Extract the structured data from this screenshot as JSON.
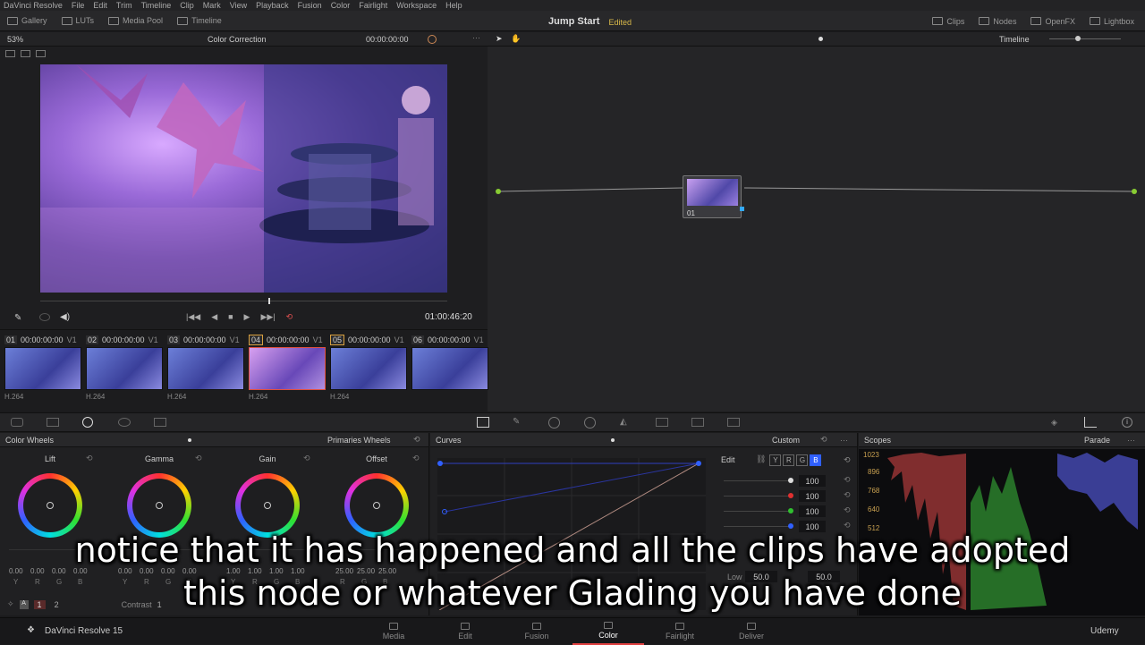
{
  "menu": [
    "DaVinci Resolve",
    "File",
    "Edit",
    "Trim",
    "Timeline",
    "Clip",
    "Mark",
    "View",
    "Playback",
    "Fusion",
    "Color",
    "Fairlight",
    "Workspace",
    "Help"
  ],
  "toolbar": {
    "left": [
      "Gallery",
      "LUTs",
      "Media Pool",
      "Timeline"
    ],
    "project_title": "Jump Start",
    "project_status": "Edited",
    "right": [
      "Clips",
      "Nodes",
      "OpenFX",
      "Lightbox"
    ]
  },
  "viewer": {
    "zoom": "53%",
    "mode": "Color Correction",
    "timecode": "00:00:00:00",
    "playhead_timecode": "01:00:46:20",
    "playhead_fraction": 0.56
  },
  "node_editor": {
    "label": "Timeline",
    "node_label": "01"
  },
  "clips": [
    {
      "num": "01",
      "tc": "00:00:00:00",
      "track": "V1",
      "codec": "H.264"
    },
    {
      "num": "02",
      "tc": "00:00:00:00",
      "track": "V1",
      "codec": "H.264"
    },
    {
      "num": "03",
      "tc": "00:00:00:00",
      "track": "V1",
      "codec": "H.264"
    },
    {
      "num": "04",
      "tc": "00:00:00:00",
      "track": "V1",
      "codec": "H.264"
    },
    {
      "num": "05",
      "tc": "00:00:00:00",
      "track": "V1",
      "codec": "H.264"
    },
    {
      "num": "06",
      "tc": "00:00:00:00",
      "track": "V1",
      "codec": ""
    }
  ],
  "color_wheels": {
    "title": "Color Wheels",
    "mode": "Primaries Wheels",
    "wheels": [
      {
        "label": "Lift",
        "values": [
          "0.00",
          "0.00",
          "0.00",
          "0.00"
        ],
        "channels": [
          "Y",
          "R",
          "G",
          "B"
        ]
      },
      {
        "label": "Gamma",
        "values": [
          "0.00",
          "0.00",
          "0.00",
          "0.00"
        ],
        "channels": [
          "Y",
          "R",
          "G",
          "B"
        ]
      },
      {
        "label": "Gain",
        "values": [
          "1.00",
          "1.00",
          "1.00",
          "1.00"
        ],
        "channels": [
          "Y",
          "R",
          "G",
          "B"
        ]
      },
      {
        "label": "Offset",
        "values": [
          "25.00",
          "25.00",
          "25.00"
        ],
        "channels": [
          "R",
          "G",
          "B"
        ]
      }
    ],
    "contrast_label": "Contrast",
    "contrast_value": "1"
  },
  "curves": {
    "title": "Curves",
    "mode": "Custom",
    "edit_label": "Edit",
    "channels": [
      "Y",
      "R",
      "G",
      "B"
    ],
    "intensity": [
      "100",
      "100",
      "100",
      "100"
    ],
    "low_label": "Low",
    "low_value": "50.0",
    "high_value": "50.0"
  },
  "scopes": {
    "title": "Scopes",
    "mode": "Parade",
    "ticks": [
      "1023",
      "896",
      "768",
      "640",
      "512"
    ]
  },
  "pages": [
    "Media",
    "Edit",
    "Fusion",
    "Color",
    "Fairlight",
    "Deliver"
  ],
  "active_page": "Color",
  "footer": {
    "app_name": "DaVinci Resolve 15",
    "watermark": "Udemy"
  },
  "subtitle": {
    "line1": "notice that it has happened and all the clips have adopted",
    "line2": "this node or whatever Glading you have done"
  }
}
